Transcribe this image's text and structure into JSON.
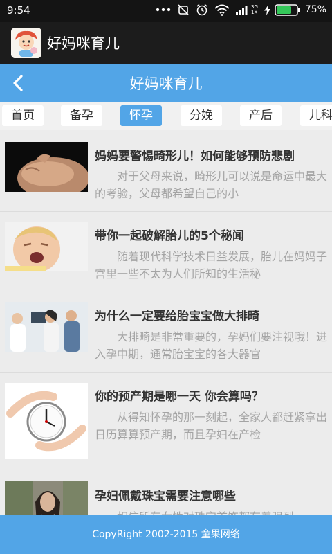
{
  "status_bar": {
    "time": "9:54",
    "network_label": "3G\n1X",
    "battery_percent": "75%",
    "battery_level": 0.75,
    "icons": [
      "notification-dots-icon",
      "mute-icon",
      "alarm-icon",
      "wifi-icon",
      "signal-icon",
      "charging-icon",
      "battery-icon"
    ]
  },
  "app_bar": {
    "title": "好妈咪育儿",
    "logo_icon": "mascot-logo-icon"
  },
  "nav": {
    "title": "好妈咪育儿",
    "back_icon": "back-chevron-icon"
  },
  "tabs": [
    {
      "label": "首页",
      "active": false
    },
    {
      "label": "备孕",
      "active": false
    },
    {
      "label": "怀孕",
      "active": true
    },
    {
      "label": "分娩",
      "active": false
    },
    {
      "label": "产后",
      "active": false
    },
    {
      "label": "儿科",
      "active": false
    }
  ],
  "articles": [
    {
      "title": "妈妈要警惕畸形儿！如何能够预防悲剧",
      "desc": "对于父母来说，畸形儿可以说是命运中最大的考验，父母都希望自己的小"
    },
    {
      "title": "带你一起破解胎儿的5个秘闻",
      "desc": "随着现代科学技术日益发展，胎儿在妈妈子宫里一些不太为人们所知的生活秘"
    },
    {
      "title": "为什么一定要给胎宝宝做大排畸",
      "desc": "大排畸是非常重要的，孕妈们要注视哦！进入孕中期，通常胎宝宝的各大器官"
    },
    {
      "title": "你的预产期是哪一天 你会算吗？",
      "desc": "从得知怀孕的那一刻起，全家人都赶紧拿出日历算算预产期，而且孕妇在产检"
    },
    {
      "title": "孕妇佩戴珠宝需要注意哪些",
      "desc": "相信所有女性对珠宝首饰都有着强烈"
    }
  ],
  "footer": {
    "text": "CopyRight 2002-2015 童果网络"
  },
  "colors": {
    "accent": "#52a5e7",
    "status_bar": "#141414",
    "app_bar": "#1c1c1c",
    "background": "#ececec"
  }
}
